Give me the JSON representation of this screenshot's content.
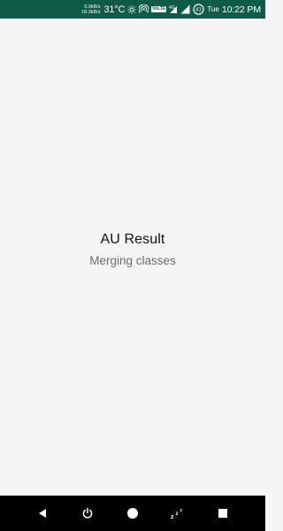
{
  "status_bar": {
    "net_up": "9.9kB/s",
    "net_down": "18.3kB/s",
    "temperature": "31°C",
    "volte": "VoLTE",
    "network_type": "4G",
    "battery_level": "41",
    "day": "Tue",
    "time": "10:22 PM",
    "background_color": "#0f5b46"
  },
  "main": {
    "title": "AU Result",
    "subtitle": "Merging classes"
  },
  "nav_bar": {
    "buttons": [
      "back-icon",
      "power-icon",
      "home-icon",
      "sleep-icon",
      "recents-icon"
    ]
  }
}
